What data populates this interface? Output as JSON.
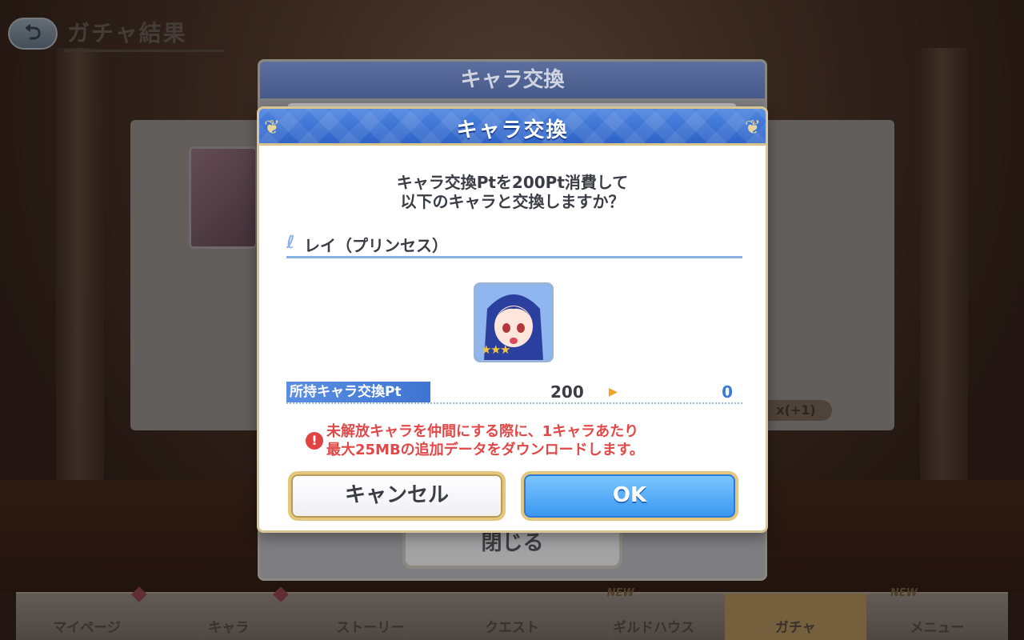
{
  "page": {
    "title": "ガチャ結果",
    "back_icon": "back-arrow-icon"
  },
  "background": {
    "badge": "x(+1)",
    "dialog_title": "キャラ交換",
    "close_label": "閉じる"
  },
  "bottom_nav": {
    "items": [
      {
        "label": "マイページ",
        "new": ""
      },
      {
        "label": "キャラ",
        "new": ""
      },
      {
        "label": "ストーリー",
        "new": ""
      },
      {
        "label": "クエスト",
        "new": ""
      },
      {
        "label": "ギルドハウス",
        "new": "NEW"
      },
      {
        "label": "ガチャ",
        "new": ""
      },
      {
        "label": "メニュー",
        "new": "NEW"
      }
    ]
  },
  "dialog": {
    "title": "キャラ交換",
    "message_line1": "キャラ交換Ptを200Pt消費して",
    "message_line2": "以下のキャラと交換しますか？",
    "character_name": "レイ（プリンセス）",
    "character_stars": 3,
    "points_label": "所持キャラ交換Pt",
    "points_current": "200",
    "points_after": "0",
    "warning_line1": "未解放キャラを仲間にする際に、1キャラあたり",
    "warning_line2": "最大25MBの追加データをダウンロードします。",
    "cancel_label": "キャンセル",
    "ok_label": "OK"
  },
  "colors": {
    "header_blue": "#3f72d6",
    "ok_blue": "#3a95f0",
    "warning_red": "#e34848",
    "gold_border": "#e4c77c"
  }
}
